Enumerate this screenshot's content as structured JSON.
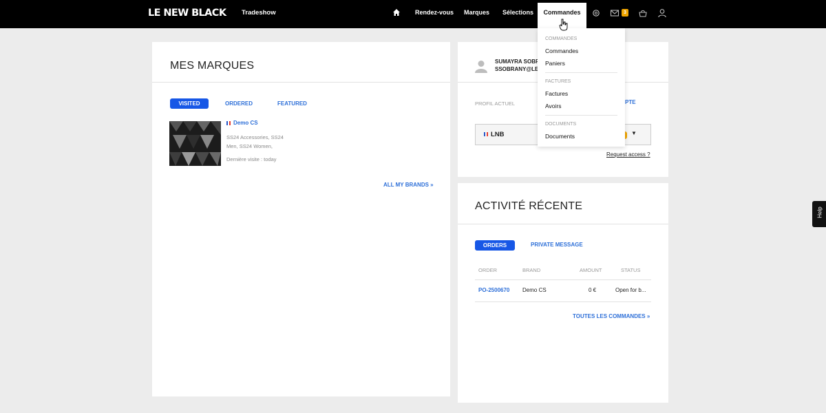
{
  "header": {
    "logo": "LE NEW BLACK",
    "tradeshow": "Tradeshow",
    "nav": [
      "Rendez-vous",
      "Marques",
      "Sélections",
      "Commandes"
    ],
    "active": "Commandes",
    "messages_badge": "3"
  },
  "dropdown": {
    "sections": [
      {
        "heading": "COMMANDES",
        "items": [
          "Commandes",
          "Paniers"
        ]
      },
      {
        "heading": "FACTURES",
        "items": [
          "Factures",
          "Avoirs"
        ]
      },
      {
        "heading": "DOCUMENTS",
        "items": [
          "Documents"
        ]
      }
    ]
  },
  "brands": {
    "title": "MES MARQUES",
    "tabs": [
      "VISITED",
      "ORDERED",
      "FEATURED"
    ],
    "active_tab": "VISITED",
    "item": {
      "name": "Demo CS",
      "collections_line1": "SS24 Accessories, SS24",
      "collections_line2": "Men, SS24 Women,",
      "last_visit": "Dernière visite : today"
    },
    "all_link": "ALL MY BRANDS »"
  },
  "profile": {
    "name": "SUMAYRA SOBR",
    "email": "SSOBRANY@LE",
    "profile_label": "PROFIL ACTUEL",
    "account_link_partial": "PTE",
    "current_profile": "LNB",
    "request_access": "Request access ?"
  },
  "activity": {
    "title": "ACTIVITÉ RÉCENTE",
    "tabs": [
      "ORDERS",
      "PRIVATE MESSAGE"
    ],
    "active_tab": "ORDERS",
    "columns": [
      "ORDER",
      "BRAND",
      "AMOUNT",
      "STATUS"
    ],
    "rows": [
      {
        "order": "PO-2500670",
        "brand": "Demo CS",
        "amount": "0 €",
        "status": "Open for b..."
      }
    ],
    "all_link": "TOUTES LES COMMANDES »"
  },
  "help": "Help"
}
